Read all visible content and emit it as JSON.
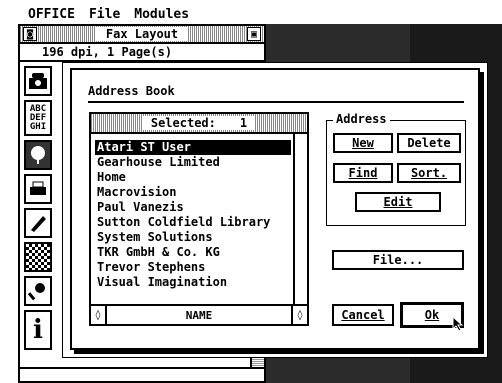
{
  "menubar": {
    "items": [
      "OFFICE",
      "File",
      "Modules"
    ]
  },
  "background_window": {
    "title": "Fax Layout",
    "info": "196 dpi,  1 Page(s)",
    "close_glyph": "◙",
    "full_glyph": "▣",
    "tools": {
      "abc_text": [
        "ABC",
        "DEF",
        "GHI"
      ],
      "info_glyph": "i"
    }
  },
  "dialog": {
    "title": "Address Book",
    "list": {
      "header_label": "Selected:",
      "selected_count": "1",
      "items": [
        "Atari ST User",
        "Gearhouse Limited",
        "Home",
        "Macrovision",
        "Paul Vanezis",
        "Sutton Coldfield Library",
        "System Solutions",
        "TKR GmbH & Co. KG",
        "Trevor Stephens",
        "Visual Imagination"
      ],
      "selected_index": 0,
      "sort_field": "NAME",
      "left_arrow": "◊",
      "right_arrow": "◊",
      "up_arrow": "⇧",
      "down_arrow": "⇩"
    },
    "address_group": {
      "label": "Address",
      "new_label": "New",
      "delete_label": "Delete",
      "find_label": "Find",
      "sort_label": "Sort.",
      "edit_label": "Edit"
    },
    "file_label": "File...",
    "cancel_label": "Cancel",
    "ok_label": "Ok"
  }
}
